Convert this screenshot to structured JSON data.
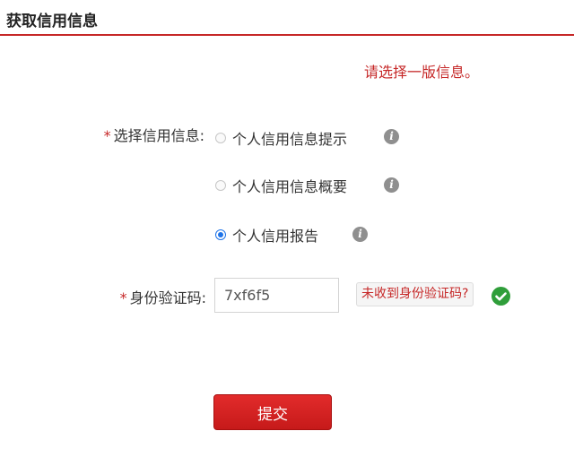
{
  "header": {
    "title": "获取信用信息"
  },
  "notice": "请选择一版信息。",
  "form": {
    "required_mark": "*",
    "info_label": "选择信用信息:",
    "options": [
      {
        "label": "个人信用信息提示",
        "selected": false
      },
      {
        "label": "个人信用信息概要",
        "selected": false
      },
      {
        "label": "个人信用报告",
        "selected": true
      }
    ],
    "code_label": "身份验证码:",
    "code_value": "7xf6f5",
    "resend_label": "未收到身份验证码?",
    "code_status": "valid"
  },
  "submit_label": "提交",
  "icons": {
    "info": "info-icon",
    "valid": "check-circle-icon"
  },
  "colors": {
    "accent": "#c62828",
    "radio_selected": "#1e73e8",
    "valid": "#2f9e3a"
  }
}
